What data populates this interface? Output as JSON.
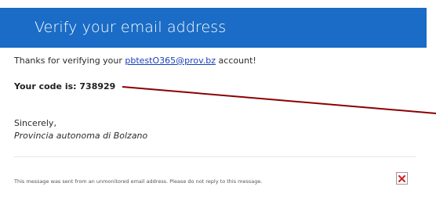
{
  "header": {
    "title": "Verify your email address",
    "background_color": "#1a6cc6"
  },
  "message": {
    "thanks_prefix": "Thanks for verifying your ",
    "email": "pbtestO365@prov.bz",
    "thanks_suffix": " account!",
    "code_line": "Your code is: 738929",
    "sincerely": "Sincerely,",
    "signature": "Provincia autonoma di Bolzano"
  },
  "footer": {
    "note": "This message was sent from an unmonitored email address. Please do not reply to this message.",
    "image_icon": "broken-image-icon"
  },
  "annotation": {
    "type": "arrow-line",
    "color": "#8b0000"
  }
}
